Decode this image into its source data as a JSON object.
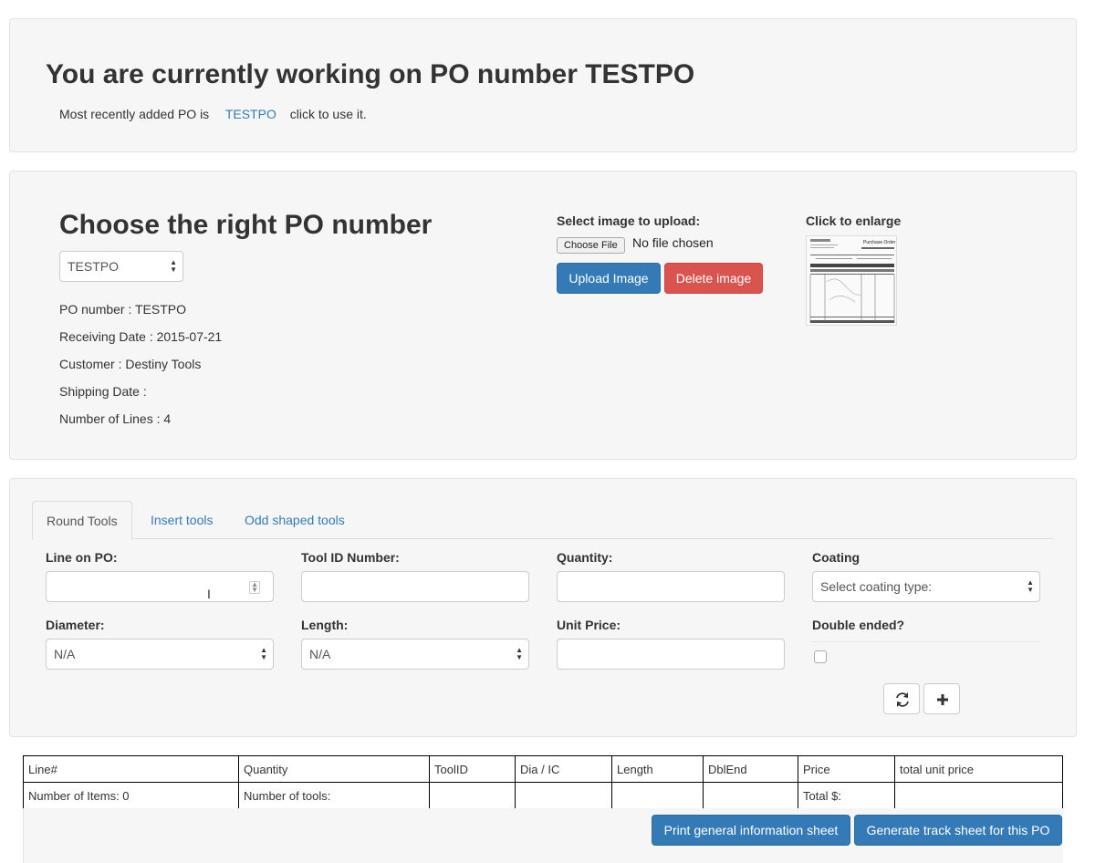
{
  "header": {
    "title": "You are currently working on PO number TESTPO",
    "recent_label": "Most recently added PO is",
    "recent_link": "TESTPO",
    "recent_suffix": "click to use it."
  },
  "po_panel": {
    "title": "Choose the right PO number",
    "selected_po": "TESTPO",
    "details": [
      "PO number : TESTPO",
      "Receiving Date : 2015-07-21",
      "Customer : Destiny Tools",
      "Shipping Date :",
      "Number of Lines : 4"
    ],
    "upload_label": "Select image to upload:",
    "choose_file": "Choose File",
    "no_file": "No file chosen",
    "upload_button": "Upload Image",
    "delete_button": "Delete image",
    "enlarge_label": "Click to enlarge",
    "thumbnail_header": "Purchase Order"
  },
  "tabs": [
    "Round Tools",
    "Insert tools",
    "Odd shaped tools"
  ],
  "form": {
    "line_label": "Line on PO:",
    "tool_id_label": "Tool ID Number:",
    "quantity_label": "Quantity:",
    "coating_label": "Coating",
    "coating_value": "Select coating type:",
    "diameter_label": "Diameter:",
    "diameter_value": "N/A",
    "length_label": "Length:",
    "length_value": "N/A",
    "unit_price_label": "Unit Price:",
    "double_ended_label": "Double ended?"
  },
  "summary_table": {
    "headers": [
      "Line#",
      "Quantity",
      "ToolID",
      "Dia / IC",
      "Length",
      "DblEnd",
      "Price",
      "total unit price"
    ],
    "footer": [
      "Number of Items: 0",
      "Number of tools:",
      "",
      "",
      "",
      "",
      "Total $:",
      ""
    ]
  },
  "actions": {
    "print_button": "Print general information sheet",
    "track_button": "Generate track sheet for this PO"
  },
  "colors": {
    "primary": "#337ab7",
    "danger": "#d9534f",
    "panel_bg": "#f6f6f6",
    "link": "#337ab7"
  }
}
